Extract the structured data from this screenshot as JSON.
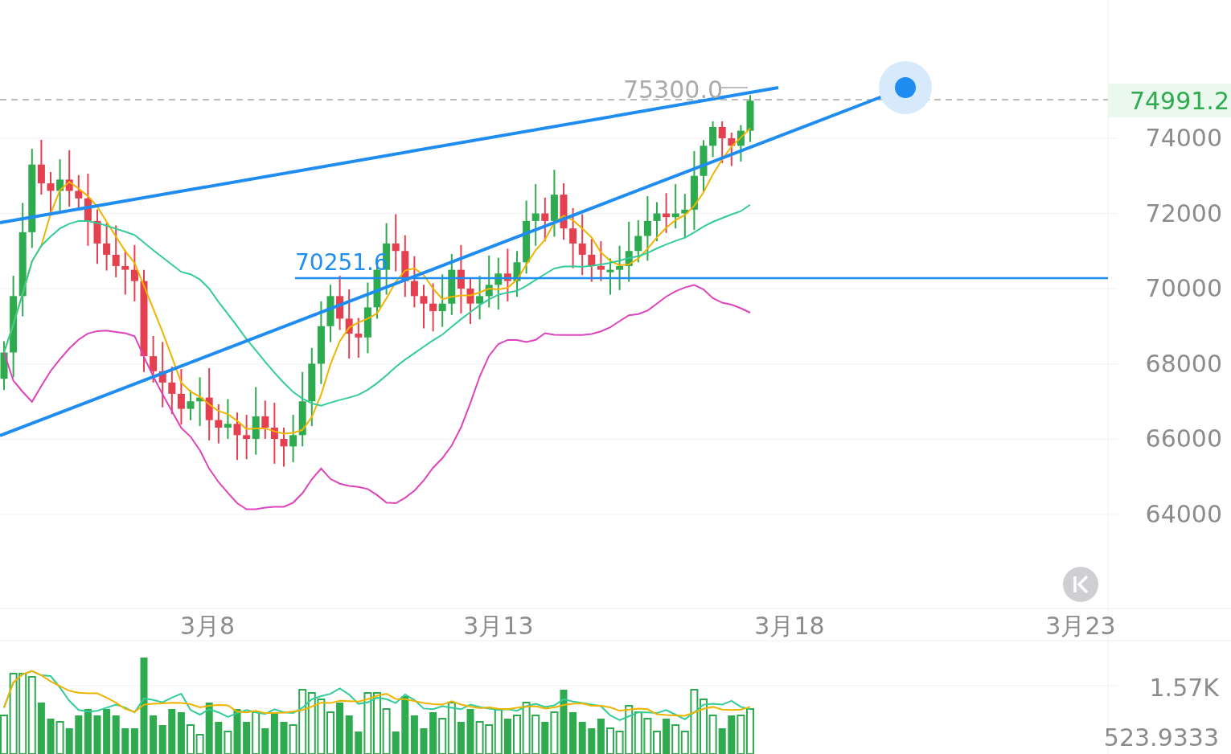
{
  "price_axis": {
    "ticks": [
      "74000",
      "72000",
      "70000",
      "68000",
      "66000",
      "64000"
    ]
  },
  "current_price": {
    "value": "74991.2"
  },
  "high_marker": {
    "label": "75300.0"
  },
  "horizontal_line": {
    "label": "70251.6"
  },
  "date_axis": {
    "ticks": [
      "3月8",
      "3月13",
      "3月18",
      "3月23"
    ]
  },
  "volume_axis": {
    "ticks": [
      "1.57K",
      "523.9333"
    ]
  }
}
